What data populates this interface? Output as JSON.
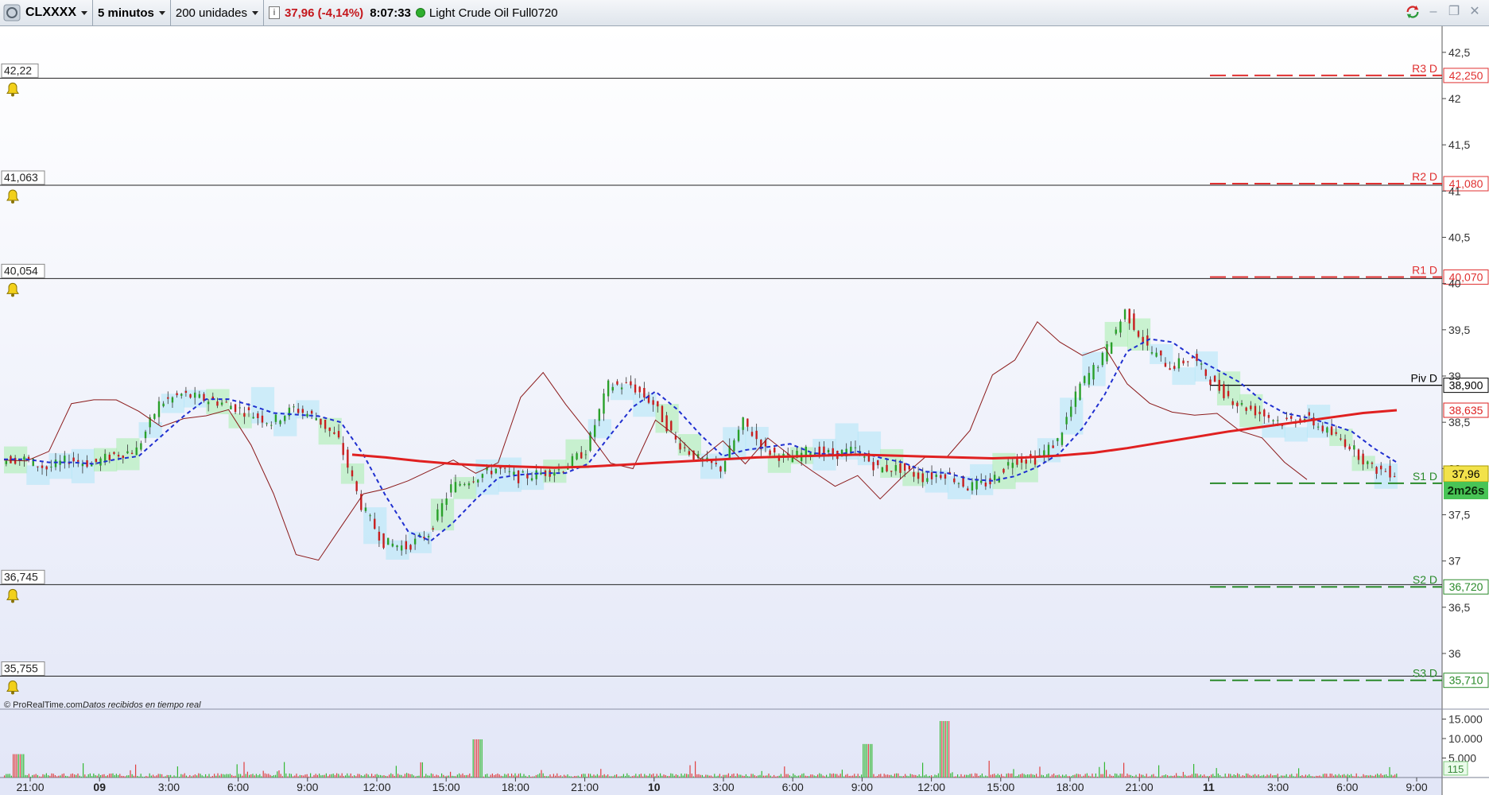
{
  "toolbar": {
    "symbol": "CLXXXX",
    "timeframe": "5 minutos",
    "units": "200 unidades",
    "info_icon": "info-icon",
    "price_change": "37,96 (-4,14%)",
    "time": "8:07:33",
    "status_color": "#2eae2e",
    "instrument": "Light Crude Oil Full0720",
    "window_controls": [
      "sync-icon",
      "minimize-icon",
      "restore-icon",
      "close-icon"
    ]
  },
  "alerts": [
    {
      "value": "42,22",
      "icon": "bell-icon"
    },
    {
      "value": "41,063",
      "icon": "bell-icon"
    },
    {
      "value": "40,054",
      "icon": "bell-icon"
    },
    {
      "value": "36,745",
      "icon": "bell-icon"
    },
    {
      "value": "35,755",
      "icon": "bell-icon"
    }
  ],
  "pivots": [
    {
      "name": "R3 D",
      "value": "42,250",
      "color": "#e03030"
    },
    {
      "name": "R2 D",
      "value": "41,080",
      "color": "#e03030"
    },
    {
      "name": "R1 D",
      "value": "40,070",
      "color": "#e03030"
    },
    {
      "name": "Piv D",
      "value": "38,900",
      "color": "#000000"
    },
    {
      "name": "S1 D",
      "value": "37,96",
      "color": "#2a8a2a"
    },
    {
      "name": "S2 D",
      "value": "36,720",
      "color": "#2a8a2a"
    },
    {
      "name": "S3 D",
      "value": "35,710",
      "color": "#2a8a2a"
    }
  ],
  "price_tags": {
    "ma_value": "38,635",
    "last_price": "37,96",
    "countdown": "2m26s",
    "volume_last": "115"
  },
  "footer_text": {
    "copyright": "© ProRealTime.com",
    "realtime": "Datos recibidos en tiempo real"
  },
  "chart_data": {
    "type": "line",
    "title": "",
    "y_ticks": [
      "42,5",
      "42",
      "41,5",
      "41",
      "40,5",
      "40",
      "39,5",
      "39",
      "38,5",
      "38",
      "37,5",
      "37",
      "36,5",
      "36"
    ],
    "ylim": [
      35.7,
      42.7
    ],
    "volume_ticks": [
      "15.000",
      "10.000",
      "5.000"
    ],
    "x_ticks": [
      {
        "label": "21:00",
        "bold": false
      },
      {
        "label": "09",
        "bold": true
      },
      {
        "label": "3:00",
        "bold": false
      },
      {
        "label": "6:00",
        "bold": false
      },
      {
        "label": "9:00",
        "bold": false
      },
      {
        "label": "12:00",
        "bold": false
      },
      {
        "label": "15:00",
        "bold": false
      },
      {
        "label": "18:00",
        "bold": false
      },
      {
        "label": "21:00",
        "bold": false
      },
      {
        "label": "10",
        "bold": true
      },
      {
        "label": "3:00",
        "bold": false
      },
      {
        "label": "6:00",
        "bold": false
      },
      {
        "label": "9:00",
        "bold": false
      },
      {
        "label": "12:00",
        "bold": false
      },
      {
        "label": "15:00",
        "bold": false
      },
      {
        "label": "18:00",
        "bold": false
      },
      {
        "label": "21:00",
        "bold": false
      },
      {
        "label": "11",
        "bold": true
      },
      {
        "label": "3:00",
        "bold": false
      },
      {
        "label": "6:00",
        "bold": false
      },
      {
        "label": "9:00",
        "bold": false
      }
    ],
    "price_series": {
      "name": "",
      "values": [
        38.1,
        38.1,
        38.0,
        38.1,
        38.05,
        38.15,
        38.2,
        38.7,
        38.8,
        38.75,
        38.7,
        38.6,
        38.5,
        38.65,
        38.55,
        38.3,
        37.6,
        37.2,
        37.15,
        37.3,
        37.8,
        37.9,
        38.0,
        37.9,
        37.95,
        38.0,
        38.2,
        38.9,
        38.9,
        38.7,
        38.3,
        38.1,
        38.0,
        38.5,
        38.2,
        38.1,
        38.2,
        38.15,
        38.2,
        38.0,
        38.0,
        37.9,
        37.95,
        37.8,
        37.85,
        38.1,
        38.1,
        38.3,
        38.9,
        39.2,
        39.7,
        39.3,
        39.1,
        39.2,
        38.9,
        38.7,
        38.6,
        38.5,
        38.55,
        38.4,
        38.25,
        38.0,
        37.95
      ]
    },
    "ma_series": {
      "name": "",
      "color": "#e02020",
      "values": [
        38.15,
        38.12,
        38.08,
        38.05,
        38.03,
        38.02,
        38.01,
        38.02,
        38.04,
        38.06,
        38.08,
        38.1,
        38.12,
        38.13,
        38.14,
        38.15,
        38.14,
        38.13,
        38.12,
        38.11,
        38.12,
        38.14,
        38.17,
        38.22,
        38.28,
        38.34,
        38.4,
        38.45,
        38.5,
        38.55,
        38.6,
        38.63
      ]
    }
  }
}
